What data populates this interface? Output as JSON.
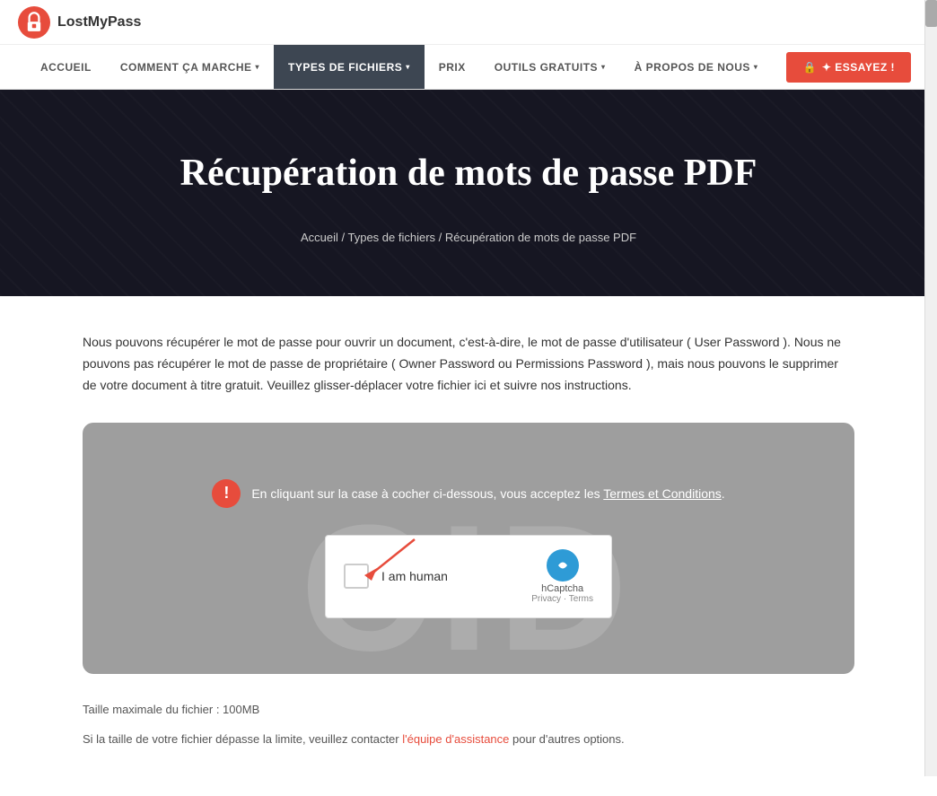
{
  "logo": {
    "text": "LostMyPass",
    "icon_label": "lock-icon"
  },
  "nav": {
    "items": [
      {
        "id": "accueil",
        "label": "ACCUEIL",
        "has_dropdown": false,
        "active": false
      },
      {
        "id": "comment",
        "label": "COMMENT ÇA MARCHE",
        "has_dropdown": true,
        "active": false
      },
      {
        "id": "types",
        "label": "TYPES DE FICHIERS",
        "has_dropdown": true,
        "active": true
      },
      {
        "id": "prix",
        "label": "PRIX",
        "has_dropdown": false,
        "active": false
      },
      {
        "id": "outils",
        "label": "OUTILS GRATUITS",
        "has_dropdown": true,
        "active": false
      },
      {
        "id": "apropos",
        "label": "À PROPOS DE NOUS",
        "has_dropdown": true,
        "active": false
      }
    ],
    "cta_button": "✦ ESSAYEZ !"
  },
  "hero": {
    "title": "Récupération de mots de passe PDF",
    "breadcrumb": {
      "home": "Accueil",
      "separator": "/",
      "types": "Types de fichiers",
      "current": "Récupération de mots de passe PDF"
    }
  },
  "description": "Nous pouvons récupérer le mot de passe pour ouvrir un document, c'est-à-dire, le mot de passe d'utilisateur ( User Password ). Nous ne pouvons pas récupérer le mot de passe de propriétaire ( Owner Password ou Permissions Password ), mais nous pouvons le supprimer de votre document à titre gratuit. Veuillez glisser-déplacer votre fichier ici et suivre nos instructions.",
  "upload_box": {
    "warning_text": "En cliquant sur la case à cocher ci-dessous, vous acceptez les ",
    "warning_link_text": "Termes et Conditions",
    "warning_link_suffix": ".",
    "captcha_label": "I am human",
    "captcha_brand": "hCaptcha",
    "captcha_privacy": "Privacy",
    "captcha_terms": "Terms",
    "watermark": "CID"
  },
  "footer_info": {
    "max_size": "Taille maximale du fichier : 100MB",
    "contact_text": "Si la taille de votre fichier dépasse la limite, veuillez contacter ",
    "contact_link": "l'équipe d'assistance",
    "contact_suffix": " pour d'autres options."
  }
}
